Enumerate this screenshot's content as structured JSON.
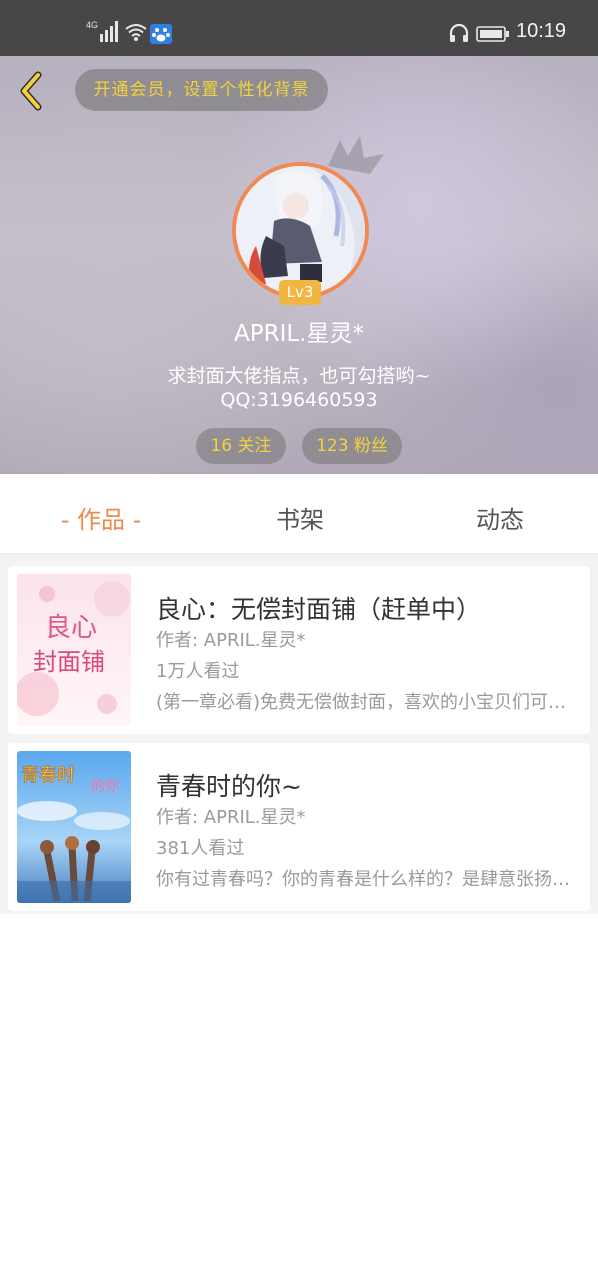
{
  "status_bar": {
    "network": "4G",
    "time": "10:19",
    "icons": [
      "signal-icon",
      "wifi-icon",
      "baidu-app-icon",
      "headphone-icon",
      "battery-icon"
    ]
  },
  "header": {
    "back_icon": "chevron-left-icon",
    "vip_prompt": "开通会员，设置个性化背景"
  },
  "profile": {
    "level": "Lv3",
    "nickname": "APRIL.星灵*",
    "bio_line1": "求封面大佬指点，也可勾搭哟~",
    "bio_line2": "QQ:3196460593",
    "following": "16 关注",
    "fans": "123 粉丝"
  },
  "tabs": [
    {
      "label": "- 作品 -",
      "active": true
    },
    {
      "label": "书架",
      "active": false
    },
    {
      "label": "动态",
      "active": false
    }
  ],
  "books": [
    {
      "title": "良心：无偿封面铺（赶单中）",
      "author": "作者: APRIL.星灵*",
      "views": "1万人看过",
      "description": "(第一章必看)免费无偿做封面，喜欢的小宝贝们可以来找我哦",
      "cover_text": "良心封面铺"
    },
    {
      "title": "青春时的你~",
      "author": "作者: APRIL.星灵*",
      "views": "381人看过",
      "description": "你有过青春吗？你的青春是什么样的？是肆意张扬还是安静美好",
      "cover_text": "青春时的你"
    }
  ],
  "colors": {
    "accent": "#ee8a4a",
    "gold": "#f4d23c",
    "status_bar": "#474747",
    "avatar_ring": "#f08a52"
  }
}
